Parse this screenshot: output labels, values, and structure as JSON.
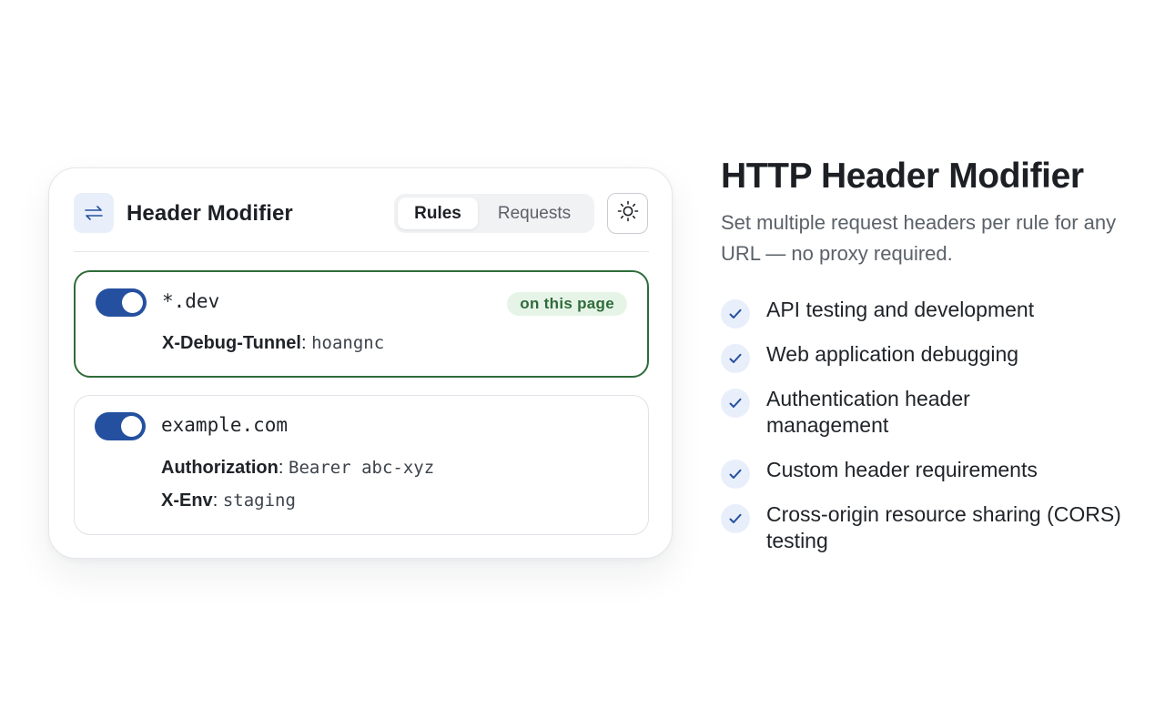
{
  "popup": {
    "title": "Header Modifier",
    "logo_icon": "swap-arrows-icon",
    "tabs": [
      {
        "label": "Rules",
        "active": true
      },
      {
        "label": "Requests",
        "active": false
      }
    ],
    "theme_icon": "sun-icon",
    "rules": [
      {
        "enabled": true,
        "pattern": "*.dev",
        "badge": "on this page",
        "headers": [
          {
            "name": "X-Debug-Tunnel",
            "separator": ": ",
            "value": "hoangnc"
          }
        ]
      },
      {
        "enabled": true,
        "pattern": "example.com",
        "headers": [
          {
            "name": "Authorization",
            "separator": ": ",
            "value": "Bearer abc-xyz"
          },
          {
            "name": "X-Env",
            "separator": ": ",
            "value": "staging"
          }
        ]
      }
    ]
  },
  "marketing": {
    "headline": "HTTP Header Modifier",
    "subtitle": "Set multiple request headers per rule for any URL — no proxy required.",
    "features": [
      "API testing and development",
      "Web application debugging",
      "Authentication header management",
      "Custom header requirements",
      "Cross-origin resource sharing (CORS) testing"
    ],
    "check_icon": "checkmark-icon"
  },
  "colors": {
    "accent": "#2550a0",
    "active_rule_border": "#2f6b3a",
    "badge_bg": "#e6f4e8",
    "badge_text": "#2f6b3a",
    "icon_bg": "#e8effb"
  }
}
